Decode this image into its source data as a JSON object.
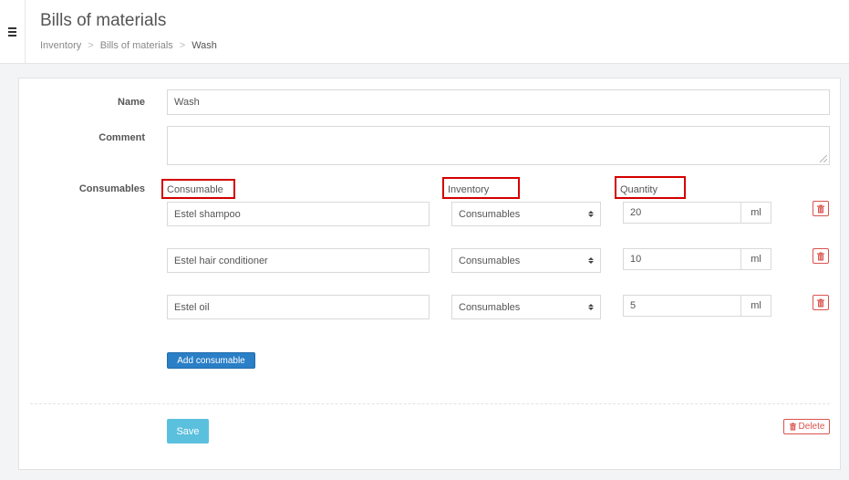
{
  "header": {
    "title": "Bills of materials",
    "breadcrumb": [
      {
        "label": "Inventory"
      },
      {
        "label": "Bills of materials"
      },
      {
        "label": "Wash"
      }
    ],
    "separator": ">"
  },
  "form": {
    "name_label": "Name",
    "name_value": "Wash",
    "comment_label": "Comment",
    "comment_value": "",
    "consumables_label": "Consumables",
    "columns": {
      "consumable": "Consumable",
      "inventory": "Inventory",
      "quantity": "Quantity"
    },
    "rows": [
      {
        "consumable": "Estel shampoo",
        "inventory": "Consumables",
        "quantity": "20",
        "unit": "ml"
      },
      {
        "consumable": "Estel hair conditioner",
        "inventory": "Consumables",
        "quantity": "10",
        "unit": "ml"
      },
      {
        "consumable": "Estel oil",
        "inventory": "Consumables",
        "quantity": "5",
        "unit": "ml"
      }
    ],
    "add_consumable_label": "Add consumable",
    "save_label": "Save",
    "delete_label": "Delete"
  },
  "colors": {
    "accent": "#2a7fc6",
    "save": "#5bc0de",
    "danger": "#d9534f",
    "highlight": "#d40000"
  },
  "icons": {
    "menu": "hamburger-icon",
    "row_delete": "trash-icon",
    "delete": "trash-icon",
    "select": "select-arrows-icon"
  }
}
